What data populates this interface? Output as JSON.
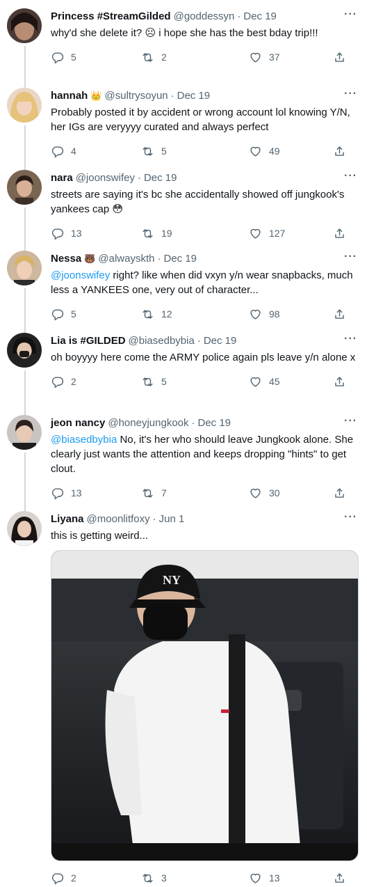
{
  "tweets": [
    {
      "name": "Princess #StreamGilded",
      "handle": "@goddessyn",
      "dot": "·",
      "date": "Dec 19",
      "body": "why'd she delete it? ☹ i hope she has the best bday trip!!!",
      "replies": "5",
      "retweets": "2",
      "likes": "37"
    },
    {
      "name": "hannah",
      "name_emoji": "👑",
      "handle": "@sultrysoyun",
      "dot": "·",
      "date": "Dec 19",
      "body": "Probably posted it by accident or wrong account lol knowing Y/N, her IGs are veryyyy curated and always perfect",
      "replies": "4",
      "retweets": "5",
      "likes": "49"
    },
    {
      "name": "nara",
      "handle": "@joonswifey",
      "dot": "·",
      "date": "Dec 19",
      "body": "streets are saying it's bc she accidentally showed off jungkook's yankees cap 😳",
      "replies": "13",
      "retweets": "19",
      "likes": "127"
    },
    {
      "name": "Nessa",
      "name_emoji": "🐻",
      "handle": "@alwayskth",
      "dot": "·",
      "date": "Dec 19",
      "mention": "@joonswifey",
      "body": " right? like when did vxyn y/n wear snapbacks, much less a YANKEES one, very out of character...",
      "replies": "5",
      "retweets": "12",
      "likes": "98"
    },
    {
      "name": "Lia is #GILDED",
      "handle": "@biasedbybia",
      "dot": "·",
      "date": "Dec 19",
      "body": "oh boyyyy here come the ARMY police again pls leave y/n alone x",
      "replies": "2",
      "retweets": "5",
      "likes": "45"
    },
    {
      "name": "jeon nancy",
      "handle": "@honeyjungkook",
      "dot": "·",
      "date": "Dec 19",
      "mention": "@biasedbybia",
      "body": " No, it's her who should leave Jungkook alone. She clearly just wants the attention and keeps dropping \"hints\" to get clout.",
      "replies": "13",
      "retweets": "7",
      "likes": "30"
    },
    {
      "name": "Liyana",
      "handle": "@moonlitfoxy",
      "dot": "·",
      "date": "Jun 1",
      "body": "this is getting weird...",
      "replies": "2",
      "retweets": "3",
      "likes": "13"
    }
  ],
  "more_label": "···",
  "icons": {
    "reply": "reply-icon",
    "retweet": "retweet-icon",
    "like": "heart-icon",
    "share": "share-icon"
  },
  "colors": {
    "text": "#0f1419",
    "muted": "#536471",
    "link": "#1d9bf0",
    "line": "#cfd9de"
  }
}
